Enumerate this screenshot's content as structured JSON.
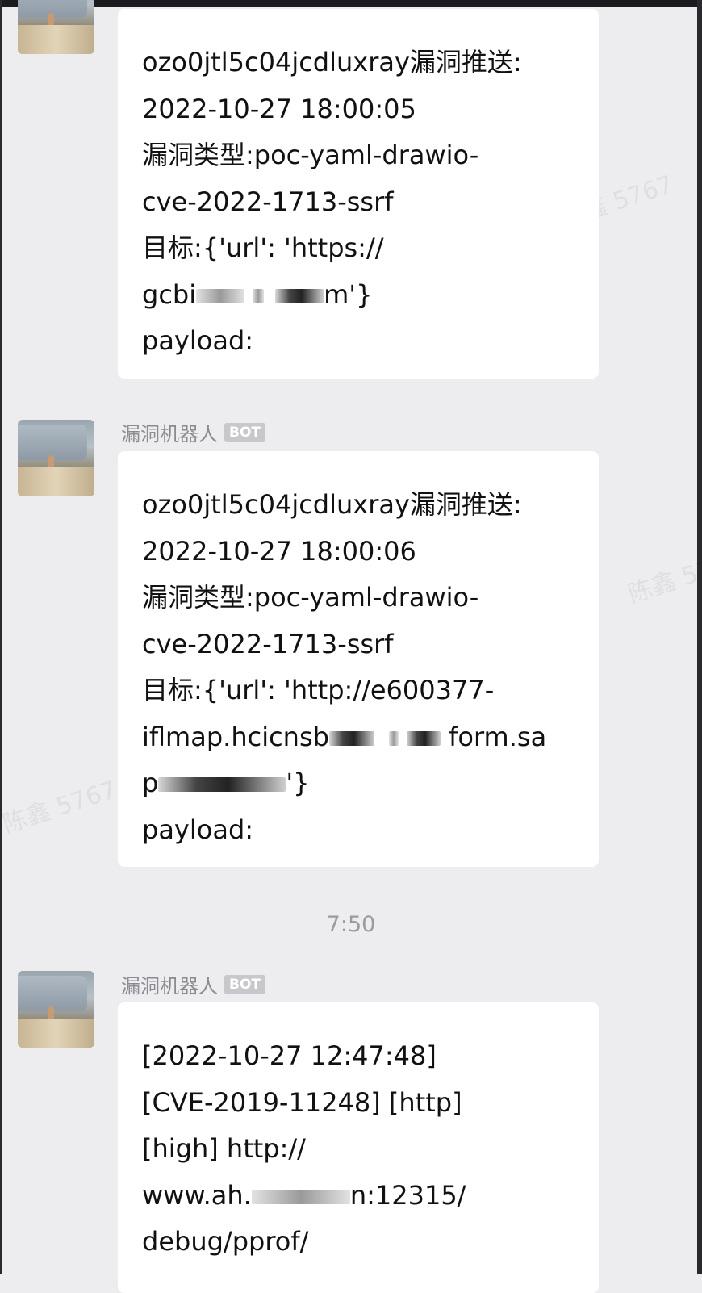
{
  "watermark": "陈鑫 5767",
  "bot_name": "漏洞机器人",
  "bot_badge": "BOT",
  "messages": [
    {
      "lines": [
        "ozo0jtl5c04jcdluxray漏洞推送:",
        "2022-10-27 18:00:05",
        "漏洞类型:poc-yaml-drawio-",
        "cve-2022-1713-ssrf",
        "目标:{'url': 'https://",
        "gcbi",
        "m'}",
        "payload:"
      ]
    },
    {
      "lines": [
        "ozo0jtl5c04jcdluxray漏洞推送:",
        "2022-10-27 18:00:06",
        "漏洞类型:poc-yaml-drawio-",
        "cve-2022-1713-ssrf",
        "目标:{'url': 'http://e600377-",
        "iflmap.hcicnsb",
        "form.sa",
        "p",
        "'}",
        "payload:"
      ]
    },
    {
      "lines": [
        "[2022-10-27 12:47:48]",
        "[CVE-2019-11248] [http]",
        "[high] http://",
        "www.ah.",
        "n:12315/",
        "debug/pprof/"
      ]
    }
  ],
  "timestamp": "7:50"
}
